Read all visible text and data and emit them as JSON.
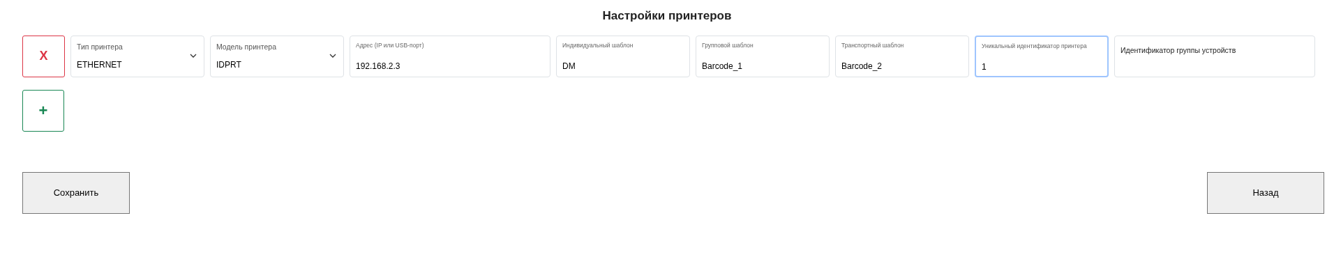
{
  "title": "Настройки принтеров",
  "remove_button": {
    "label": "X"
  },
  "fields": [
    {
      "kind": "select",
      "label": "Тип принтера",
      "value": "ETHERNET",
      "focused": false
    },
    {
      "kind": "select",
      "label": "Модель принтера",
      "value": "IDPRT",
      "focused": false
    },
    {
      "kind": "text",
      "label": "Адрес (IP или USB-порт)",
      "value": "192.168.2.3",
      "focused": false
    },
    {
      "kind": "text",
      "label": "Индивидуальный шаблон",
      "value": "DM",
      "focused": false
    },
    {
      "kind": "text",
      "label": "Групповой шаблон",
      "value": "Barcode_1",
      "focused": false
    },
    {
      "kind": "text",
      "label": "Транспортный шаблон",
      "value": "Barcode_2",
      "focused": false
    },
    {
      "kind": "text",
      "label": "Уникальный идентификатор принтера",
      "value": "1",
      "focused": true
    },
    {
      "kind": "empty",
      "placeholder": "Идентификатор группы устройств",
      "focused": false
    }
  ],
  "add_button": {
    "label": "+"
  },
  "save_button": {
    "label": "Сохранить"
  },
  "back_button": {
    "label": "Назад"
  }
}
